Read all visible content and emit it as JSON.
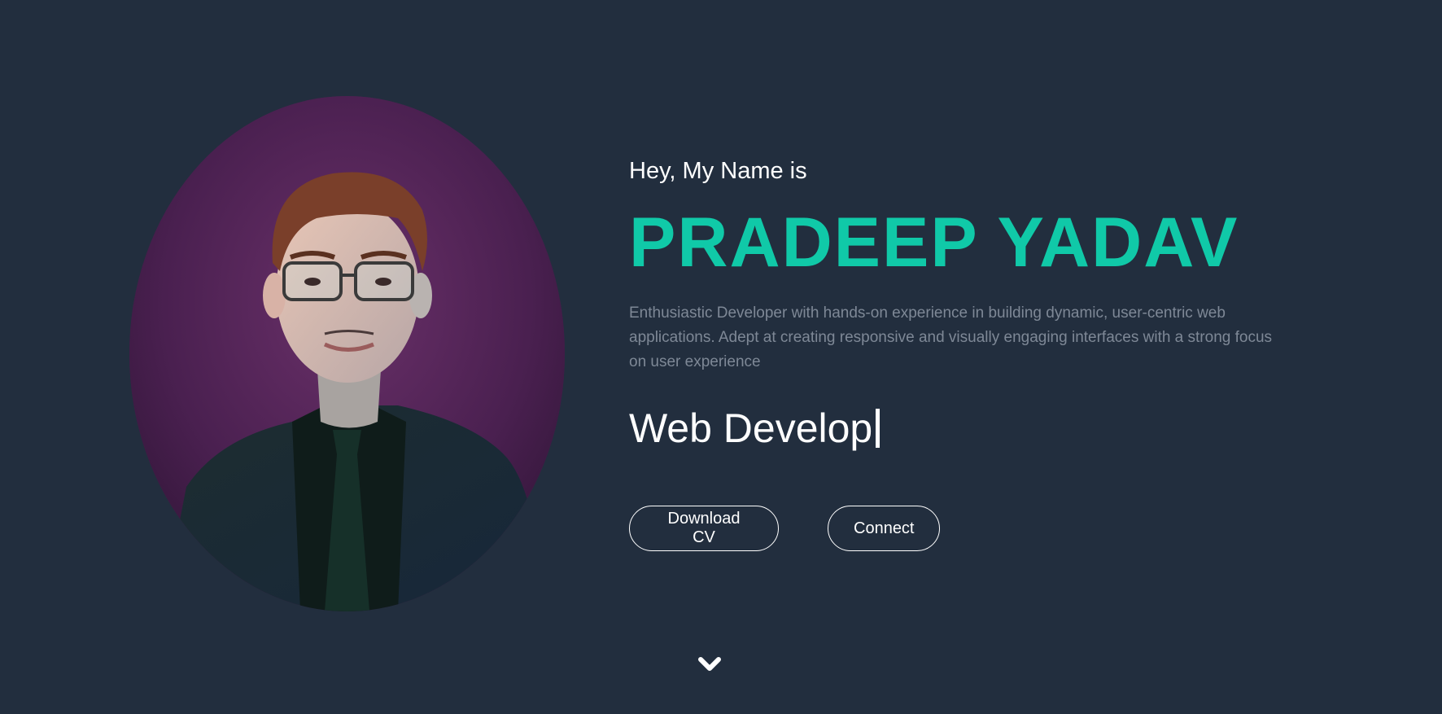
{
  "hero": {
    "greeting": "Hey, My Name is",
    "name": "PRADEEP YADAV",
    "bio": "Enthusiastic Developer with hands-on experience in building dynamic, user-centric web applications. Adept at creating responsive and visually engaging interfaces with a strong focus on user experience",
    "typed_role": "Web Develop"
  },
  "actions": {
    "download_cv_label": "Download CV",
    "connect_label": "Connect"
  },
  "icons": {
    "scroll": "chevron-down-icon",
    "profile": "profile-photo"
  },
  "colors": {
    "background": "#222e3e",
    "accent": "#10c9a8",
    "bio_text": "#7e8896",
    "text": "#ffffff"
  }
}
